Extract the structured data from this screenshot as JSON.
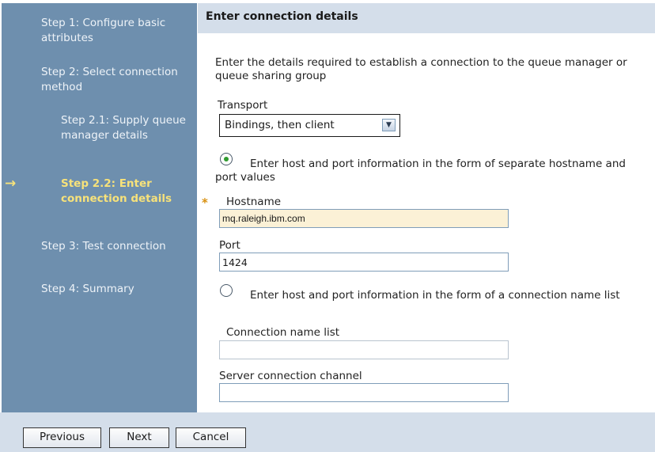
{
  "sidebar": {
    "steps": [
      {
        "label": "Step 1: Configure basic attributes"
      },
      {
        "label": "Step 2: Select connection method"
      },
      {
        "label": "Step 2.1: Supply queue manager details"
      },
      {
        "label": "Step 2.2: Enter connection details"
      },
      {
        "label": "Step 3: Test connection"
      },
      {
        "label": "Step 4: Summary"
      }
    ],
    "current_arrow": "→"
  },
  "header": {
    "title": "Enter connection details"
  },
  "form": {
    "intro": "Enter the details required to establish a connection to the queue manager or queue sharing group",
    "transport_label": "Transport",
    "transport_value": "Bindings, then client",
    "option1_label": "Enter host and port information in the form of separate hostname and port values",
    "option1_selected": true,
    "hostname_label": "Hostname",
    "hostname_value": "mq.raleigh.ibm.com",
    "required_marker": "*",
    "port_label": "Port",
    "port_value": "1424",
    "option2_label": "Enter host and port information in the form of a connection name list",
    "option2_selected": false,
    "connlist_label": "Connection name list",
    "connlist_value": "",
    "channel_label": "Server connection channel",
    "channel_value": ""
  },
  "footer": {
    "previous": "Previous",
    "next": "Next",
    "cancel": "Cancel"
  },
  "colors": {
    "sidebar_bg": "#6e8fae",
    "header_bg": "#d4deea",
    "current_step": "#f7e27a",
    "radio_selected": "#2e9a2e",
    "required": "#d89010",
    "hostname_bg": "#fbf1d6"
  },
  "icons": {
    "current_step": "arrow-right-icon",
    "transport_dropdown": "chevron-down-icon"
  }
}
